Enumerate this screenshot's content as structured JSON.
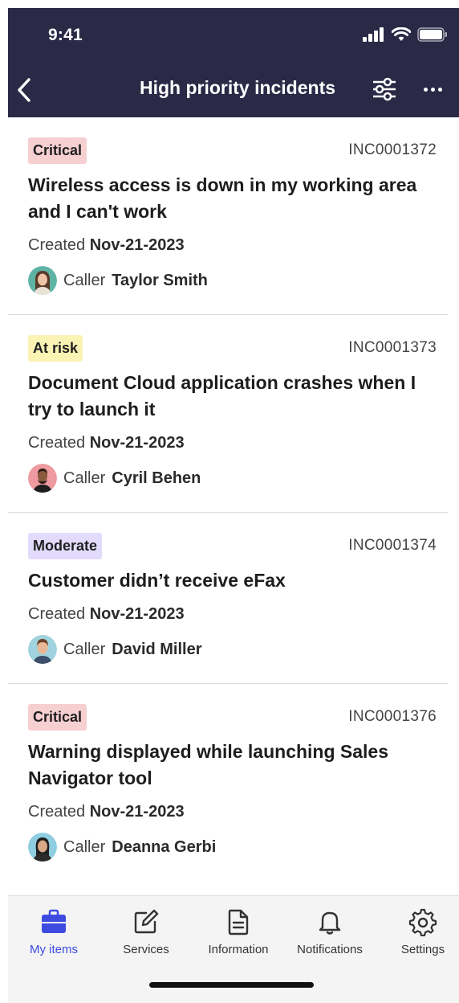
{
  "status_bar": {
    "time": "9:41"
  },
  "header": {
    "title": "High priority incidents"
  },
  "incidents": [
    {
      "priority": "Critical",
      "priority_kind": "critical",
      "number": "INC0001372",
      "title": "Wireless access is down in my working area and I can't work",
      "created_label": "Created",
      "created": "Nov-21-2023",
      "caller_label": "Caller",
      "caller": "Taylor Smith"
    },
    {
      "priority": "At risk",
      "priority_kind": "risk",
      "number": "INC0001373",
      "title": "Document Cloud application crashes when I try to launch it",
      "created_label": "Created",
      "created": "Nov-21-2023",
      "caller_label": "Caller",
      "caller": "Cyril Behen"
    },
    {
      "priority": "Moderate",
      "priority_kind": "moderate",
      "number": "INC0001374",
      "title": "Customer didn’t receive eFax",
      "created_label": "Created",
      "created": "Nov-21-2023",
      "caller_label": "Caller",
      "caller": "David Miller"
    },
    {
      "priority": "Critical",
      "priority_kind": "critical",
      "number": "INC0001376",
      "title": "Warning displayed while launching Sales Navigator tool",
      "created_label": "Created",
      "created": "Nov-21-2023",
      "caller_label": "Caller",
      "caller": "Deanna Gerbi"
    }
  ],
  "tabs": [
    {
      "label": "My items",
      "icon": "briefcase-icon",
      "active": true
    },
    {
      "label": "Services",
      "icon": "edit-icon",
      "active": false
    },
    {
      "label": "Information",
      "icon": "document-icon",
      "active": false
    },
    {
      "label": "Notifications",
      "icon": "bell-icon",
      "active": false
    },
    {
      "label": "Settings",
      "icon": "gear-icon",
      "active": false
    }
  ],
  "colors": {
    "header_bg": "#2a2946",
    "accent": "#3d4be0",
    "critical": "#f6cfd1",
    "at_risk": "#fbf3b4",
    "moderate": "#e2dbfb"
  }
}
